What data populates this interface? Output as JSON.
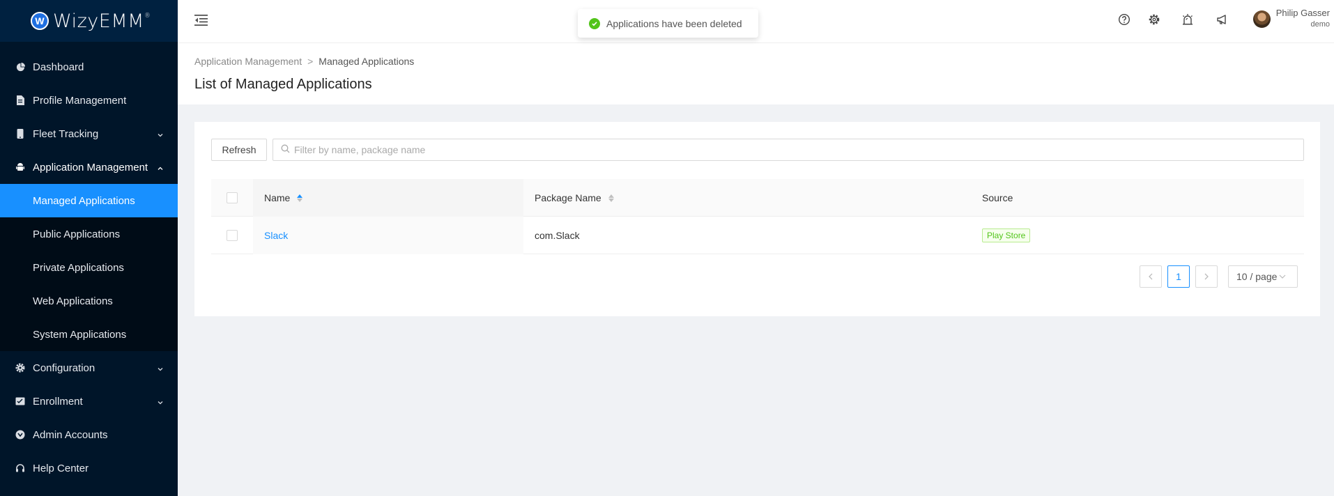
{
  "brand": {
    "badge": "W",
    "name": "WizyEMM",
    "mark": "®"
  },
  "sidebar": {
    "items": [
      {
        "label": "Dashboard",
        "icon": "dashboard-icon"
      },
      {
        "label": "Profile Management",
        "icon": "file-icon"
      },
      {
        "label": "Fleet Tracking",
        "icon": "mobile-icon"
      },
      {
        "label": "Application Management",
        "icon": "android-icon"
      }
    ],
    "submenu": [
      {
        "label": "Managed Applications",
        "active": true
      },
      {
        "label": "Public Applications"
      },
      {
        "label": "Private Applications"
      },
      {
        "label": "Web Applications"
      },
      {
        "label": "System Applications"
      }
    ],
    "bottom": [
      {
        "label": "Configuration",
        "icon": "gear-icon"
      },
      {
        "label": "Enrollment",
        "icon": "enrollment-icon"
      },
      {
        "label": "Admin Accounts",
        "icon": "admin-icon"
      },
      {
        "label": "Help Center",
        "icon": "headset-icon"
      }
    ]
  },
  "header": {
    "icons": [
      "help-icon",
      "settings-icon",
      "alarm-icon",
      "announcement-icon"
    ],
    "user": {
      "name": "Philip Gasser",
      "role": "demo"
    }
  },
  "toast": {
    "message": "Applications have been deleted",
    "status_color": "#52c41a"
  },
  "breadcrumb": {
    "parent": "Application Management",
    "separator": ">",
    "current": "Managed Applications"
  },
  "page": {
    "title": "List of Managed Applications"
  },
  "toolbar": {
    "refresh_label": "Refresh",
    "search_placeholder": "Filter by name, package name"
  },
  "table": {
    "columns": [
      "Name",
      "Package Name",
      "Source"
    ],
    "rows": [
      {
        "name": "Slack",
        "package": "com.Slack",
        "source": "Play Store"
      }
    ]
  },
  "pagination": {
    "current": "1",
    "page_size": "10 / page"
  },
  "colors": {
    "accent": "#1890ff",
    "sidebar": "#001529",
    "success": "#52c41a"
  }
}
